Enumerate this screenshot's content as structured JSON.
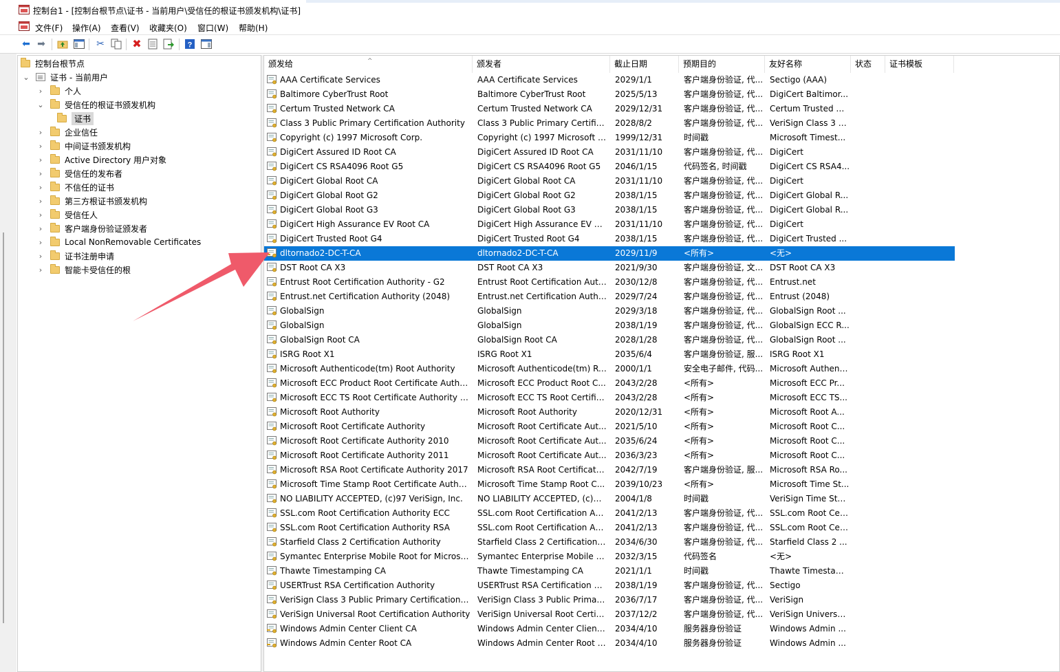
{
  "window": {
    "title": "控制台1 - [控制台根节点\\证书 - 当前用户\\受信任的根证书颁发机构\\证书]"
  },
  "menu": [
    "文件(F)",
    "操作(A)",
    "查看(V)",
    "收藏夹(O)",
    "窗口(W)",
    "帮助(H)"
  ],
  "toolbar": {
    "icons": [
      "back-icon",
      "forward-icon",
      "up-folder-icon",
      "show-hide-tree-icon",
      "cut-icon",
      "copy-icon",
      "delete-icon",
      "properties-icon",
      "export-icon",
      "help-icon",
      "show-hide-action-icon"
    ]
  },
  "tree": {
    "root": "控制台根节点",
    "certs_user": "证书 - 当前用户",
    "items": [
      {
        "label": "个人"
      },
      {
        "label": "受信任的根证书颁发机构"
      },
      {
        "label": "证书"
      },
      {
        "label": "企业信任"
      },
      {
        "label": "中间证书颁发机构"
      },
      {
        "label": "Active Directory 用户对象"
      },
      {
        "label": "受信任的发布者"
      },
      {
        "label": "不信任的证书"
      },
      {
        "label": "第三方根证书颁发机构"
      },
      {
        "label": "受信任人"
      },
      {
        "label": "客户端身份验证颁发者"
      },
      {
        "label": "Local NonRemovable Certificates"
      },
      {
        "label": "证书注册申请"
      },
      {
        "label": "智能卡受信任的根"
      }
    ]
  },
  "columns": [
    "颁发给",
    "颁发者",
    "截止日期",
    "预期目的",
    "友好名称",
    "状态",
    "证书模板"
  ],
  "selected_row": 12,
  "rows": [
    [
      "AAA Certificate Services",
      "AAA Certificate Services",
      "2029/1/1",
      "客户端身份验证, 代...",
      "Sectigo (AAA)"
    ],
    [
      "Baltimore CyberTrust Root",
      "Baltimore CyberTrust Root",
      "2025/5/13",
      "客户端身份验证, 代...",
      "DigiCert Baltimor..."
    ],
    [
      "Certum Trusted Network CA",
      "Certum Trusted Network CA",
      "2029/12/31",
      "客户端身份验证, 代...",
      "Certum Trusted N..."
    ],
    [
      "Class 3 Public Primary Certification Authority",
      "Class 3 Public Primary Certifica...",
      "2028/8/2",
      "客户端身份验证, 代...",
      "VeriSign Class 3 P..."
    ],
    [
      "Copyright (c) 1997 Microsoft Corp.",
      "Copyright (c) 1997 Microsoft C...",
      "1999/12/31",
      "时间戳",
      "Microsoft Timest..."
    ],
    [
      "DigiCert Assured ID Root CA",
      "DigiCert Assured ID Root CA",
      "2031/11/10",
      "客户端身份验证, 代...",
      "DigiCert"
    ],
    [
      "DigiCert CS RSA4096 Root G5",
      "DigiCert CS RSA4096 Root G5",
      "2046/1/15",
      "代码签名, 时间戳",
      "DigiCert CS RSA4..."
    ],
    [
      "DigiCert Global Root CA",
      "DigiCert Global Root CA",
      "2031/11/10",
      "客户端身份验证, 代...",
      "DigiCert"
    ],
    [
      "DigiCert Global Root G2",
      "DigiCert Global Root G2",
      "2038/1/15",
      "客户端身份验证, 代...",
      "DigiCert Global R..."
    ],
    [
      "DigiCert Global Root G3",
      "DigiCert Global Root G3",
      "2038/1/15",
      "客户端身份验证, 代...",
      "DigiCert Global R..."
    ],
    [
      "DigiCert High Assurance EV Root CA",
      "DigiCert High Assurance EV R...",
      "2031/11/10",
      "客户端身份验证, 代...",
      "DigiCert"
    ],
    [
      "DigiCert Trusted Root G4",
      "DigiCert Trusted Root G4",
      "2038/1/15",
      "客户端身份验证, 代...",
      "DigiCert Trusted ..."
    ],
    [
      "dltornado2-DC-T-CA",
      "dltornado2-DC-T-CA",
      "2029/11/9",
      "<所有>",
      "<无>"
    ],
    [
      "DST Root CA X3",
      "DST Root CA X3",
      "2021/9/30",
      "客户端身份验证, 文...",
      "DST Root CA X3"
    ],
    [
      "Entrust Root Certification Authority - G2",
      "Entrust Root Certification Auth...",
      "2030/12/8",
      "客户端身份验证, 代...",
      "Entrust.net"
    ],
    [
      "Entrust.net Certification Authority (2048)",
      "Entrust.net Certification Author...",
      "2029/7/24",
      "客户端身份验证, 代...",
      "Entrust (2048)"
    ],
    [
      "GlobalSign",
      "GlobalSign",
      "2029/3/18",
      "客户端身份验证, 代...",
      "GlobalSign Root ..."
    ],
    [
      "GlobalSign",
      "GlobalSign",
      "2038/1/19",
      "客户端身份验证, 代...",
      "GlobalSign ECC R..."
    ],
    [
      "GlobalSign Root CA",
      "GlobalSign Root CA",
      "2028/1/28",
      "客户端身份验证, 代...",
      "GlobalSign Root ..."
    ],
    [
      "ISRG Root X1",
      "ISRG Root X1",
      "2035/6/4",
      "客户端身份验证, 服...",
      "ISRG Root X1"
    ],
    [
      "Microsoft Authenticode(tm) Root Authority",
      "Microsoft Authenticode(tm) Ro...",
      "2000/1/1",
      "安全电子邮件, 代码...",
      "Microsoft Authent..."
    ],
    [
      "Microsoft ECC Product Root Certificate Author...",
      "Microsoft ECC Product Root C...",
      "2043/2/28",
      "<所有>",
      "Microsoft ECC Pr..."
    ],
    [
      "Microsoft ECC TS Root Certificate Authority 20...",
      "Microsoft ECC TS Root Certific...",
      "2043/2/28",
      "<所有>",
      "Microsoft ECC TS..."
    ],
    [
      "Microsoft Root Authority",
      "Microsoft Root Authority",
      "2020/12/31",
      "<所有>",
      "Microsoft Root A..."
    ],
    [
      "Microsoft Root Certificate Authority",
      "Microsoft Root Certificate Aut...",
      "2021/5/10",
      "<所有>",
      "Microsoft Root C..."
    ],
    [
      "Microsoft Root Certificate Authority 2010",
      "Microsoft Root Certificate Aut...",
      "2035/6/24",
      "<所有>",
      "Microsoft Root C..."
    ],
    [
      "Microsoft Root Certificate Authority 2011",
      "Microsoft Root Certificate Aut...",
      "2036/3/23",
      "<所有>",
      "Microsoft Root C..."
    ],
    [
      "Microsoft RSA Root Certificate Authority 2017",
      "Microsoft RSA Root Certificate...",
      "2042/7/19",
      "客户端身份验证, 服...",
      "Microsoft RSA Ro..."
    ],
    [
      "Microsoft Time Stamp Root Certificate Authori...",
      "Microsoft Time Stamp Root C...",
      "2039/10/23",
      "<所有>",
      "Microsoft Time St..."
    ],
    [
      "NO LIABILITY ACCEPTED, (c)97 VeriSign, Inc.",
      "NO LIABILITY ACCEPTED, (c)97...",
      "2004/1/8",
      "时间戳",
      "VeriSign Time Sta..."
    ],
    [
      "SSL.com Root Certification Authority ECC",
      "SSL.com Root Certification Aut...",
      "2041/2/13",
      "客户端身份验证, 代...",
      "SSL.com Root Cer..."
    ],
    [
      "SSL.com Root Certification Authority RSA",
      "SSL.com Root Certification Aut...",
      "2041/2/13",
      "客户端身份验证, 代...",
      "SSL.com Root Cer..."
    ],
    [
      "Starfield Class 2 Certification Authority",
      "Starfield Class 2 Certification A...",
      "2034/6/30",
      "客户端身份验证, 代...",
      "Starfield Class 2 ..."
    ],
    [
      "Symantec Enterprise Mobile Root for Microsoft",
      "Symantec Enterprise Mobile R...",
      "2032/3/15",
      "代码签名",
      "<无>"
    ],
    [
      "Thawte Timestamping CA",
      "Thawte Timestamping CA",
      "2021/1/1",
      "时间戳",
      "Thawte Timestam..."
    ],
    [
      "USERTrust RSA Certification Authority",
      "USERTrust RSA Certification Au...",
      "2038/1/19",
      "客户端身份验证, 代...",
      "Sectigo"
    ],
    [
      "VeriSign Class 3 Public Primary Certification A...",
      "VeriSign Class 3 Public Primary...",
      "2036/7/17",
      "客户端身份验证, 代...",
      "VeriSign"
    ],
    [
      "VeriSign Universal Root Certification Authority",
      "VeriSign Universal Root Certifi...",
      "2037/12/2",
      "客户端身份验证, 代...",
      "VeriSign Universa..."
    ],
    [
      "Windows Admin Center Client CA",
      "Windows Admin Center Client ...",
      "2034/4/10",
      "服务器身份验证",
      "Windows Admin ..."
    ],
    [
      "Windows Admin Center Root CA",
      "Windows Admin Center Root CA",
      "2034/4/10",
      "服务器身份验证",
      "Windows Admin ..."
    ]
  ],
  "key_icon_rows": [
    12,
    38,
    39
  ],
  "colors": {
    "selection": "#0a78d7",
    "annotation_arrow": "#ef5a6a",
    "folder": "#f2cb6e"
  }
}
